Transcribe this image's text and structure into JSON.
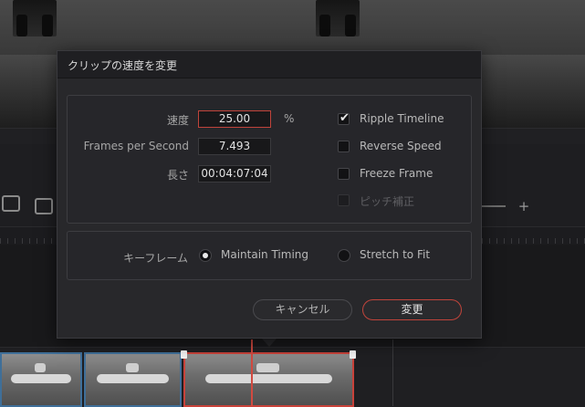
{
  "dialog": {
    "title": "クリップの速度を変更",
    "speed_label": "速度",
    "speed_value": "25.00",
    "speed_unit": "%",
    "fps_label": "Frames per Second",
    "fps_value": "7.493",
    "duration_label": "長さ",
    "duration_value": "00:04:07:04",
    "options": [
      {
        "label": "Ripple Timeline",
        "checked": true,
        "enabled": true
      },
      {
        "label": "Reverse Speed",
        "checked": false,
        "enabled": true
      },
      {
        "label": "Freeze Frame",
        "checked": false,
        "enabled": true
      },
      {
        "label": "ピッチ補正",
        "checked": false,
        "enabled": false
      }
    ],
    "keyframe_label": "キーフレーム",
    "keyframe_options": [
      {
        "label": "Maintain Timing",
        "selected": true
      },
      {
        "label": "Stretch to Fit",
        "selected": false
      }
    ],
    "cancel_label": "キャンセル",
    "apply_label": "変更"
  },
  "timeline": {
    "zoom_plus": "+"
  },
  "colors": {
    "accent": "#c0443b",
    "clip_border": "#3f6f99",
    "playhead": "#d24a40"
  }
}
